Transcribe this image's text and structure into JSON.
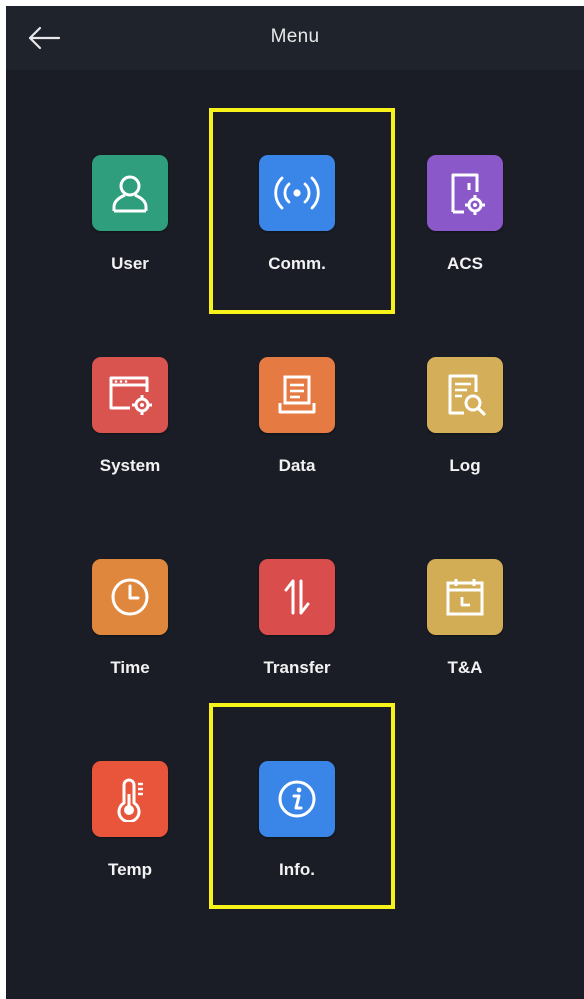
{
  "header": {
    "title": "Menu",
    "back_icon": "arrow-left-icon"
  },
  "menu": {
    "items": [
      {
        "label": "User",
        "icon": "user-icon",
        "color": "#2e9e7c"
      },
      {
        "label": "Comm.",
        "icon": "wireless-signal-icon",
        "color": "#3a86e8"
      },
      {
        "label": "ACS",
        "icon": "door-settings-icon",
        "color": "#8a58c9"
      },
      {
        "label": "System",
        "icon": "window-settings-icon",
        "color": "#d9534f"
      },
      {
        "label": "Data",
        "icon": "monitor-document-icon",
        "color": "#e57a42"
      },
      {
        "label": "Log",
        "icon": "document-search-icon",
        "color": "#d4ae58"
      },
      {
        "label": "Time",
        "icon": "clock-icon",
        "color": "#e0873e"
      },
      {
        "label": "Transfer",
        "icon": "transfer-arrows-icon",
        "color": "#d94d4d"
      },
      {
        "label": "T&A",
        "icon": "calendar-icon",
        "color": "#d3ac56"
      },
      {
        "label": "Temp",
        "icon": "thermometer-icon",
        "color": "#e8553b"
      },
      {
        "label": "Info.",
        "icon": "info-icon",
        "color": "#3a86e8"
      }
    ]
  },
  "highlighted_items": [
    "Comm.",
    "Info."
  ],
  "colors": {
    "background": "#1a1d26",
    "header": "#1f232c",
    "highlight": "#f7f21a"
  }
}
